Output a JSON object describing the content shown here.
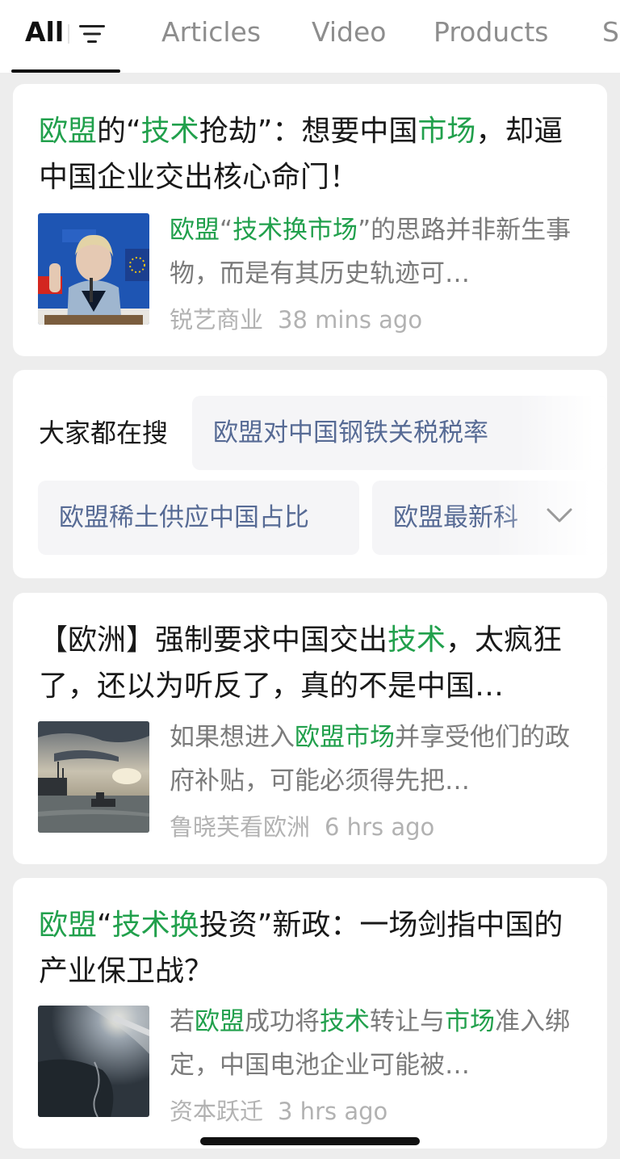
{
  "tabs": {
    "all": "All",
    "articles": "Articles",
    "video": "Video",
    "products": "Products",
    "more": "S"
  },
  "results": [
    {
      "title_parts": [
        {
          "text": "欧盟",
          "hl": true
        },
        {
          "text": "的“",
          "hl": false
        },
        {
          "text": "技术",
          "hl": true
        },
        {
          "text": "抢劫”：想要中国",
          "hl": false
        },
        {
          "text": "市场",
          "hl": true
        },
        {
          "text": "，却逼中国企业交出核心命门！",
          "hl": false
        }
      ],
      "snippet_parts": [
        {
          "text": "欧盟",
          "hl": true
        },
        {
          "text": "“",
          "hl": false
        },
        {
          "text": "技术换市场",
          "hl": true
        },
        {
          "text": "”的思路并非新生事物，而是有其历史轨迹可…",
          "hl": false
        }
      ],
      "source": "锐艺商业",
      "time": "38 mins ago"
    },
    {
      "title_parts": [
        {
          "text": "【欧洲】强制要求中国交出",
          "hl": false
        },
        {
          "text": "技术",
          "hl": true
        },
        {
          "text": "，太疯狂了，还以为听反了，真的不是中国…",
          "hl": false
        }
      ],
      "snippet_parts": [
        {
          "text": "如果想进入",
          "hl": false
        },
        {
          "text": "欧盟市场",
          "hl": true
        },
        {
          "text": "并享受他们的政府补贴，可能必须得先把…",
          "hl": false
        }
      ],
      "source": "鲁晓芙看欧洲",
      "time": "6 hrs ago"
    },
    {
      "title_parts": [
        {
          "text": "欧盟",
          "hl": true
        },
        {
          "text": "“",
          "hl": false
        },
        {
          "text": "技术换",
          "hl": true
        },
        {
          "text": "投资”新政：一场剑指中国的产业保卫战？",
          "hl": false
        }
      ],
      "snippet_parts": [
        {
          "text": "若",
          "hl": false
        },
        {
          "text": "欧盟",
          "hl": true
        },
        {
          "text": "成功将",
          "hl": false
        },
        {
          "text": "技术",
          "hl": true
        },
        {
          "text": "转让与",
          "hl": false
        },
        {
          "text": "市场",
          "hl": true
        },
        {
          "text": "准入绑定，中国电池企业可能被…",
          "hl": false
        }
      ],
      "source": "资本跃迁",
      "time": "3 hrs ago"
    }
  ],
  "suggestions": {
    "label": "大家都在搜",
    "items": [
      "欧盟对中国钢铁关税税率",
      "欧盟稀土供应中国占比",
      "欧盟最新科"
    ]
  },
  "colors": {
    "highlight": "#21a04c",
    "suggestion_text": "#576b95",
    "meta_text": "#b2b2b2"
  }
}
